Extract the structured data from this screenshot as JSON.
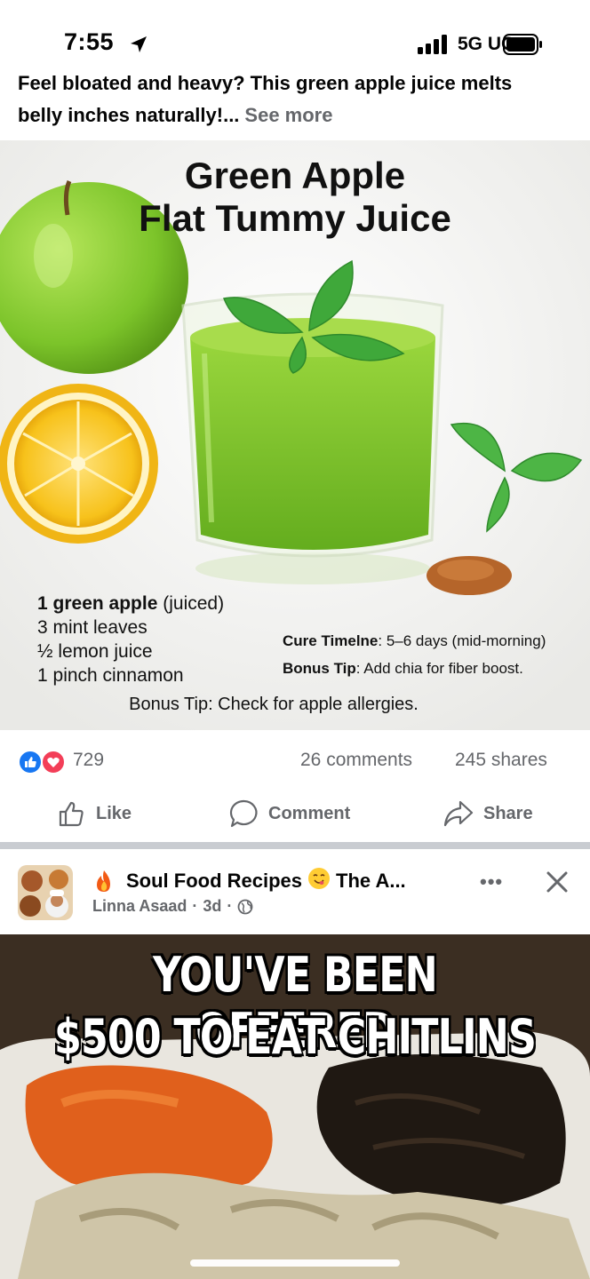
{
  "status_bar": {
    "time": "7:55",
    "network": "5G UC"
  },
  "post": {
    "caption_line1": "Feel bloated and heavy? This green apple juice melts",
    "caption_line2": "belly inches naturally!...",
    "see_more": "See more",
    "image": {
      "title_line1": "Green Apple",
      "title_line2": "Flat Tummy Juice",
      "ingredients": [
        {
          "bold": "1 green apple",
          "rest": " (juiced)"
        },
        {
          "bold": "",
          "rest": "3 mint leaves"
        },
        {
          "bold": "",
          "rest": "½ lemon juice"
        },
        {
          "bold": "",
          "rest": "1 pinch cinnamon"
        }
      ],
      "cure_label": "Cure Timelne",
      "cure_value": ": 5–6 days (mid-morning)",
      "bonus_label": "Bonus Tip",
      "bonus_value": ": Add chia for fiber boost.",
      "bonus_bottom": "Bonus Tip: Check for apple allergies."
    },
    "reaction_count": "729",
    "comments": "26 comments",
    "shares": "245 shares",
    "actions": {
      "like": "Like",
      "comment": "Comment",
      "share": "Share"
    }
  },
  "next_post": {
    "page_name_part1": "Soul Food Recipes",
    "page_name_part2": "The A...",
    "author": "Linna Asaad",
    "time": "3d",
    "more_label": "•••",
    "meme_line1": "YOU'VE BEEN OFFERED",
    "meme_line2": "$500 TO EAT CHITLINS"
  },
  "colors": {
    "facebook_blue": "#1877f2",
    "love_red": "#f33e58",
    "muted_text": "#65676b",
    "juice_green": "#7cc42a",
    "apple_green": "#8bcf2e",
    "lemon_yellow": "#f7c21b",
    "cinnamon": "#b5652a"
  },
  "icons": [
    "location-arrow-icon",
    "signal-bars-icon",
    "battery-icon",
    "like-reaction-icon",
    "love-reaction-icon",
    "thumbs-up-icon",
    "comment-bubble-icon",
    "share-arrow-icon",
    "fire-emoji-icon",
    "yum-emoji-icon",
    "globe-icon",
    "close-icon",
    "more-icon"
  ]
}
